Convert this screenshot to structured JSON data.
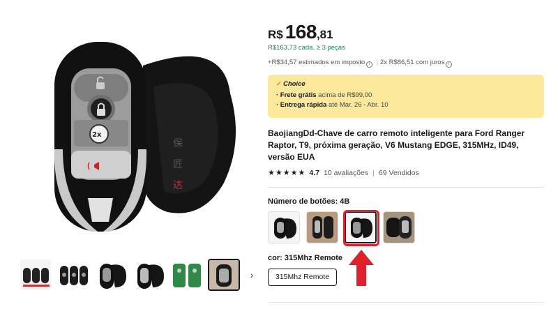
{
  "price": {
    "currency": "R$",
    "integer": "168",
    "decimal": ",81"
  },
  "bulk_price": "R$163,73 cada, ≥ 3 peças",
  "tax": {
    "tax_text": "+R$34,57 estimados em imposto",
    "installments": "2x R$86,51 com juros"
  },
  "choice": {
    "title": "Choice",
    "free_shipping_bold": "· Frete grátis",
    "free_shipping_rest": " acima de R$99,00",
    "fast_delivery_bold": "· Entrega rápida",
    "fast_delivery_rest": " até Mar. 26 - Abr. 10"
  },
  "product_title": "BaojiangDd-Chave de carro remoto inteligente para Ford Ranger Raptor, T9, próxima geração, V6 Mustang EDGE, 315MHz, ID49, versão EUA",
  "rating": {
    "value": "4.7",
    "reviews": "10 avaliações",
    "sold": "69 Vendidos"
  },
  "sku": {
    "label": "Número de botões: 4B",
    "selected_index": 2
  },
  "color": {
    "label": "cor: 315Mhz Remote",
    "option": "315Mhz Remote"
  },
  "key_buttons": {
    "mode": "2x"
  },
  "colors": {
    "accent_red": "#e0202a",
    "bulk_green": "#1b8d4a",
    "choice_bg": "#fde99b"
  },
  "icons": [
    "unlock-icon",
    "lock-icon",
    "panic-horn-icon",
    "info-icon",
    "chevron-right-icon",
    "star-icon",
    "arrow-up-icon"
  ]
}
